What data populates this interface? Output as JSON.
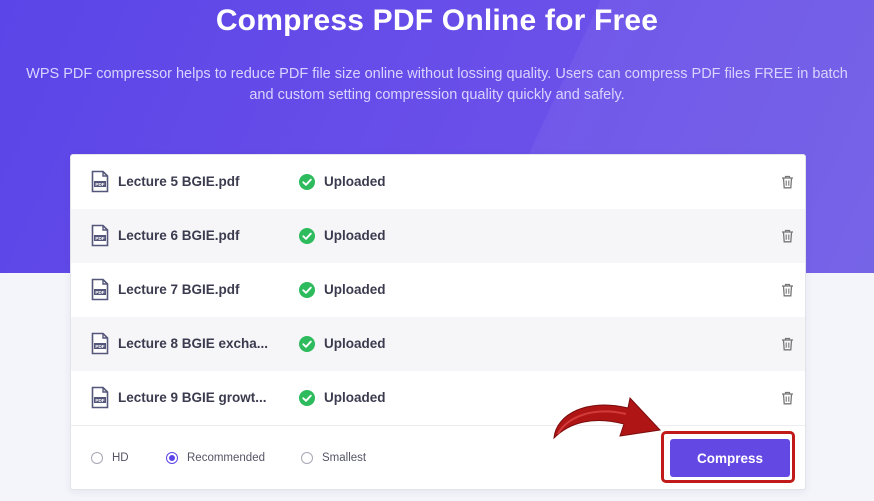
{
  "hero": {
    "title": "Compress PDF Online for Free",
    "subtitle_line1": "WPS PDF compressor helps to reduce PDF file size online without lossing quality. Users can compress PDF files FREE in batch",
    "subtitle_line2": "and custom setting compression quality quickly and safely."
  },
  "files": [
    {
      "name": "Lecture 5 BGIE.pdf",
      "status": "Uploaded",
      "icon": "pdf-file-icon",
      "status_icon": "check-circle-icon",
      "action_icon": "trash-icon"
    },
    {
      "name": "Lecture 6 BGIE.pdf",
      "status": "Uploaded",
      "icon": "pdf-file-icon",
      "status_icon": "check-circle-icon",
      "action_icon": "trash-icon"
    },
    {
      "name": "Lecture 7 BGIE.pdf",
      "status": "Uploaded",
      "icon": "pdf-file-icon",
      "status_icon": "check-circle-icon",
      "action_icon": "trash-icon"
    },
    {
      "name": "Lecture 8 BGIE excha...",
      "status": "Uploaded",
      "icon": "pdf-file-icon",
      "status_icon": "check-circle-icon",
      "action_icon": "trash-icon"
    },
    {
      "name": "Lecture 9 BGIE growt...",
      "status": "Uploaded",
      "icon": "pdf-file-icon",
      "status_icon": "check-circle-icon",
      "action_icon": "trash-icon"
    }
  ],
  "quality_options": [
    {
      "label": "HD",
      "selected": false
    },
    {
      "label": "Recommended",
      "selected": true
    },
    {
      "label": "Smallest",
      "selected": false
    }
  ],
  "compress_button": {
    "label": "Compress"
  },
  "colors": {
    "accent": "#6348e4",
    "hero_gradient_start": "#5b45e8",
    "hero_gradient_end": "#6f5ce6",
    "success": "#2dbb5d",
    "annotation": "#c01a1a"
  }
}
